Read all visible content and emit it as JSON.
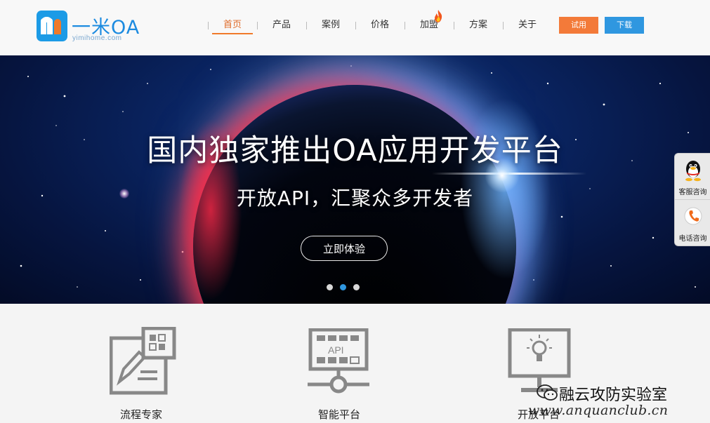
{
  "brand": {
    "name": "一米OA",
    "domain": "yimihome.com"
  },
  "nav": {
    "items": [
      {
        "label": "首页",
        "active": true
      },
      {
        "label": "产品",
        "active": false
      },
      {
        "label": "案例",
        "active": false
      },
      {
        "label": "价格",
        "active": false
      },
      {
        "label": "加盟",
        "active": false,
        "icon": "fire-icon"
      },
      {
        "label": "方案",
        "active": false
      },
      {
        "label": "关于",
        "active": false
      }
    ],
    "trial_label": "试用",
    "download_label": "下载"
  },
  "banner": {
    "title": "国内独家推出OA应用开发平台",
    "subtitle": "开放API，汇聚众多开发者",
    "cta_label": "立即体验",
    "slides": 3,
    "active_slide": 2
  },
  "side_bar": {
    "items": [
      {
        "label": "客服咨询",
        "icon": "qq-penguin-icon"
      },
      {
        "label": "电话咨询",
        "icon": "phone-icon"
      }
    ]
  },
  "features": [
    {
      "title": "流程专家",
      "icon": "workflow-document-icon"
    },
    {
      "title": "智能平台",
      "icon": "api-platform-icon"
    },
    {
      "title": "开放平台",
      "icon": "lightbulb-monitor-icon"
    }
  ],
  "watermark": {
    "brand": "融云攻防实验室",
    "url": "www.anquanclub.cn",
    "icon": "wechat-icon"
  },
  "colors": {
    "accent_orange": "#f37a39",
    "accent_blue": "#2f97e0",
    "logo_blue": "#1c9be6"
  }
}
